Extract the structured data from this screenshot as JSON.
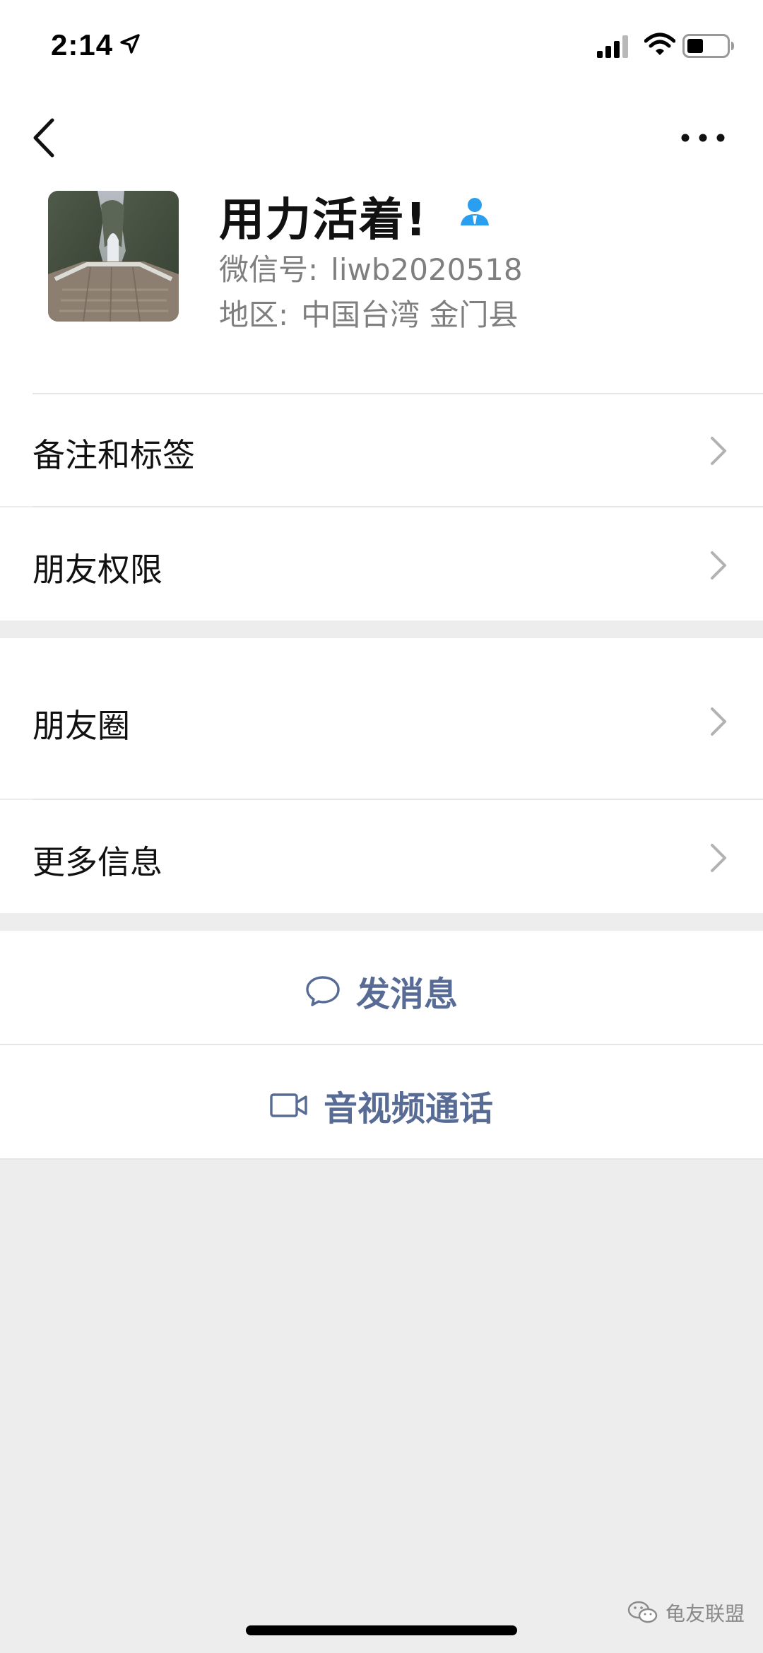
{
  "status_bar": {
    "time": "2:14",
    "icons": [
      "location-arrow-icon",
      "cellular-signal-icon",
      "wifi-icon",
      "battery-icon"
    ]
  },
  "nav": {
    "back_icon": "chevron-left-icon",
    "more_icon": "ellipsis-icon"
  },
  "profile": {
    "name": "用力活着!",
    "wechat_id_label": "微信号:",
    "wechat_id": "liwb2020518",
    "region_label": "地区:",
    "region": "中国台湾 金门县",
    "badge_icon": "contact-person-icon",
    "badge_color": "#2a9ff0"
  },
  "menu_sections": [
    [
      {
        "label": "备注和标签",
        "icon": "chevron-right-icon"
      },
      {
        "label": "朋友权限",
        "icon": "chevron-right-icon"
      }
    ],
    [
      {
        "label": "朋友圈",
        "icon": "chevron-right-icon"
      },
      {
        "label": "更多信息",
        "icon": "chevron-right-icon"
      }
    ]
  ],
  "actions": [
    {
      "label": "发消息",
      "icon": "chat-bubble-icon"
    },
    {
      "label": "音视频通话",
      "icon": "video-camera-icon"
    }
  ],
  "watermark": {
    "text": "龟友联盟",
    "icon": "wechat-logo-icon"
  },
  "colors": {
    "background": "#ededed",
    "surface": "#ffffff",
    "link": "#576b95",
    "secondary_text": "#7f7f7f",
    "chevron": "#b2b2b2"
  }
}
